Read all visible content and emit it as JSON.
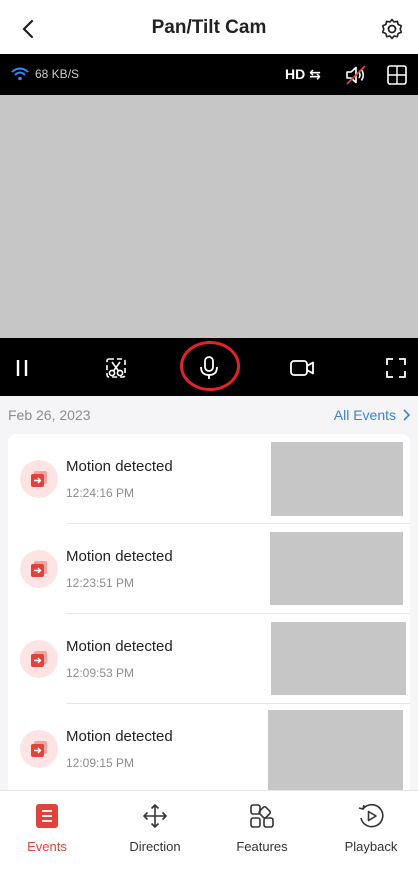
{
  "header": {
    "title": "Pan/Tilt Cam"
  },
  "status": {
    "speed": "68 KB/S",
    "quality": "HD"
  },
  "date_row": {
    "date": "Feb 26, 2023",
    "all_events": "All Events"
  },
  "events": [
    {
      "title": "Motion detected",
      "time": "12:24:16 PM"
    },
    {
      "title": "Motion detected",
      "time": "12:23:51 PM"
    },
    {
      "title": "Motion detected",
      "time": "12:09:53 PM"
    },
    {
      "title": "Motion detected",
      "time": "12:09:15 PM"
    }
  ],
  "tabs": [
    {
      "label": "Events"
    },
    {
      "label": "Direction"
    },
    {
      "label": "Features"
    },
    {
      "label": "Playback"
    }
  ],
  "colors": {
    "accent": "#e0433b",
    "link": "#3b82d6",
    "highlight_ring": "#e3232a"
  }
}
